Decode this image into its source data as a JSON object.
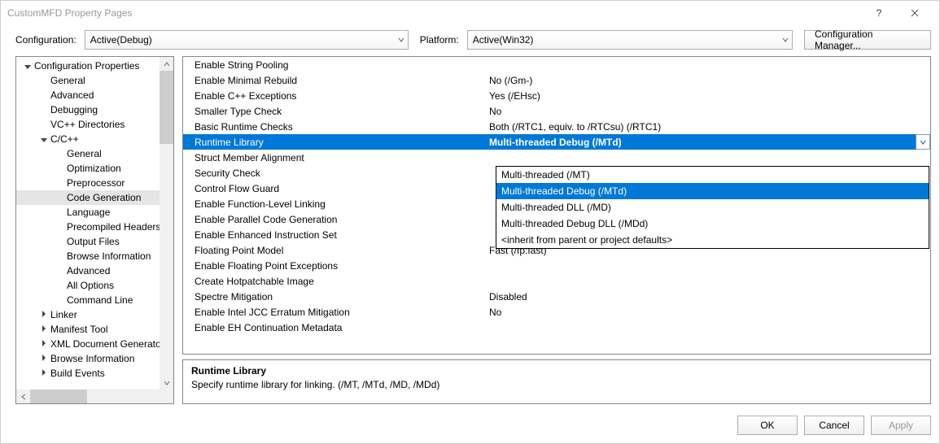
{
  "window": {
    "title": "CustomMFD Property Pages"
  },
  "toolbar": {
    "config_label": "Configuration:",
    "config_value": "Active(Debug)",
    "platform_label": "Platform:",
    "platform_value": "Active(Win32)",
    "config_manager": "Configuration Manager..."
  },
  "tree": {
    "root": "Configuration Properties",
    "general": "General",
    "advanced": "Advanced",
    "debugging": "Debugging",
    "vcdirs": "VC++ Directories",
    "cpp": "C/C++",
    "cpp_children": {
      "general": "General",
      "optimization": "Optimization",
      "preprocessor": "Preprocessor",
      "codegen": "Code Generation",
      "language": "Language",
      "pch": "Precompiled Headers",
      "output": "Output Files",
      "browse": "Browse Information",
      "advanced": "Advanced",
      "allopts": "All Options",
      "cmdline": "Command Line"
    },
    "linker": "Linker",
    "manifest": "Manifest Tool",
    "xmldoc": "XML Document Generator",
    "browseinfo": "Browse Information",
    "buildevents": "Build Events"
  },
  "grid": {
    "rows": [
      {
        "label": "Enable String Pooling",
        "value": ""
      },
      {
        "label": "Enable Minimal Rebuild",
        "value": "No (/Gm-)"
      },
      {
        "label": "Enable C++ Exceptions",
        "value": "Yes (/EHsc)"
      },
      {
        "label": "Smaller Type Check",
        "value": "No"
      },
      {
        "label": "Basic Runtime Checks",
        "value": "Both (/RTC1, equiv. to /RTCsu) (/RTC1)"
      },
      {
        "label": "Runtime Library",
        "value": "Multi-threaded Debug (/MTd)"
      },
      {
        "label": "Struct Member Alignment",
        "value": ""
      },
      {
        "label": "Security Check",
        "value": ""
      },
      {
        "label": "Control Flow Guard",
        "value": ""
      },
      {
        "label": "Enable Function-Level Linking",
        "value": ""
      },
      {
        "label": "Enable Parallel Code Generation",
        "value": ""
      },
      {
        "label": "Enable Enhanced Instruction Set",
        "value": ""
      },
      {
        "label": "Floating Point Model",
        "value": "Fast (/fp:fast)"
      },
      {
        "label": "Enable Floating Point Exceptions",
        "value": ""
      },
      {
        "label": "Create Hotpatchable Image",
        "value": ""
      },
      {
        "label": "Spectre Mitigation",
        "value": "Disabled"
      },
      {
        "label": "Enable Intel JCC Erratum Mitigation",
        "value": "No"
      },
      {
        "label": "Enable EH Continuation Metadata",
        "value": ""
      }
    ],
    "selected_index": 5
  },
  "combo": {
    "options": [
      "Multi-threaded (/MT)",
      "Multi-threaded Debug (/MTd)",
      "Multi-threaded DLL (/MD)",
      "Multi-threaded Debug DLL (/MDd)",
      "<inherit from parent or project defaults>"
    ],
    "selected_index": 1
  },
  "description": {
    "heading": "Runtime Library",
    "text": "Specify runtime library for linking.     (/MT, /MTd, /MD, /MDd)"
  },
  "footer": {
    "ok": "OK",
    "cancel": "Cancel",
    "apply": "Apply"
  }
}
